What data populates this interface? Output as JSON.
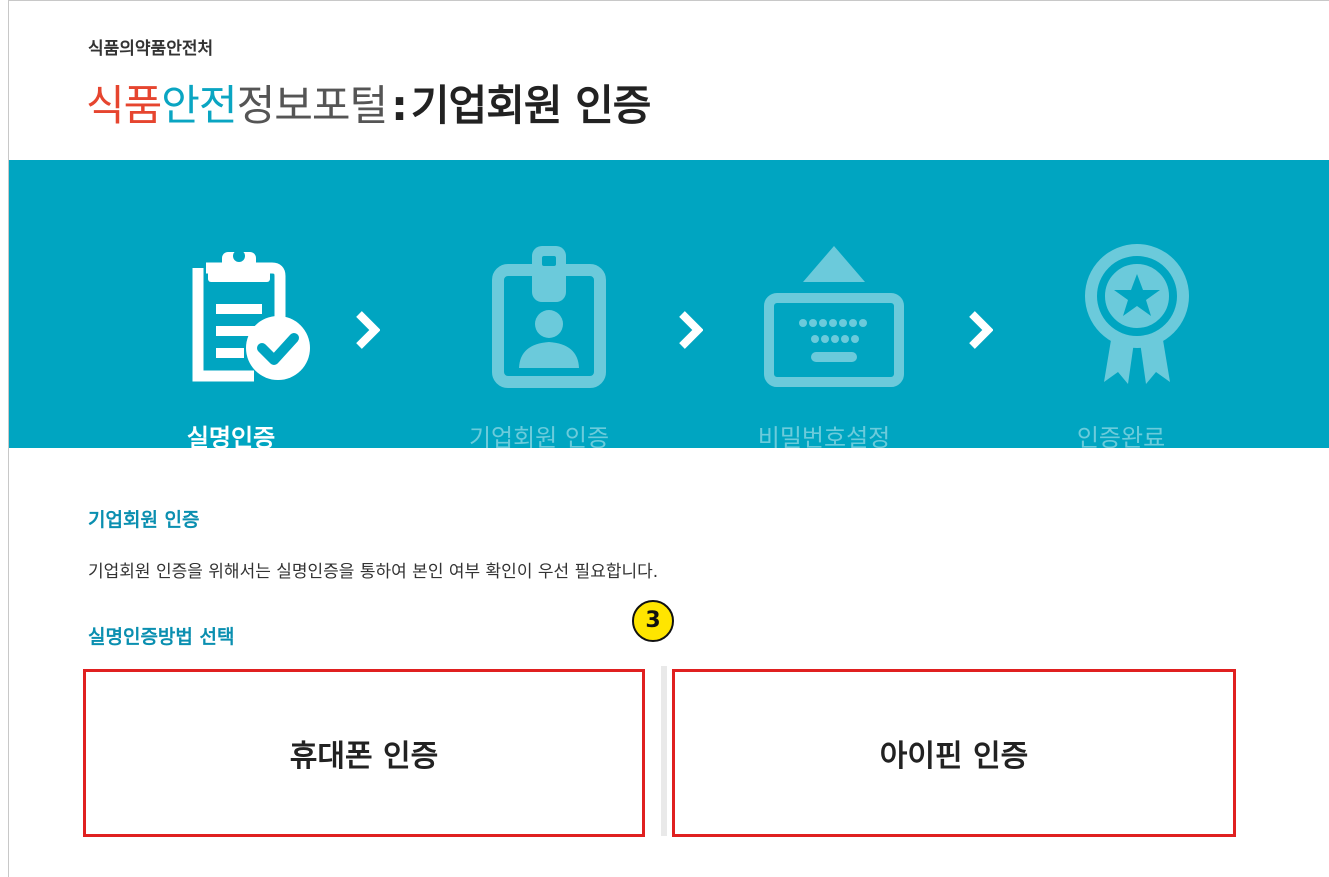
{
  "header": {
    "agency": "식품의약품안전처",
    "title_part1": "식품",
    "title_part2": "안전",
    "title_part3": "정보포털",
    "title_sep": ":",
    "title_part4": "기업회원 인증"
  },
  "steps": [
    {
      "label": "실명인증",
      "icon": "clipboard-check-icon",
      "active": true
    },
    {
      "label": "기업회원 인증",
      "icon": "id-badge-icon",
      "active": false
    },
    {
      "label": "비밀번호설정",
      "icon": "keyboard-icon",
      "active": false
    },
    {
      "label": "인증완료",
      "icon": "award-medal-icon",
      "active": false
    }
  ],
  "main": {
    "section_title": "기업회원 인증",
    "description": "기업회원 인증을 위해서는 실명인증을 통하여 본인 여부 확인이 우선 필요합니다.",
    "method_title": "실명인증방법 선택",
    "annotation_badge": "3",
    "buttons": {
      "phone": "휴대폰 인증",
      "ipin": "아이핀 인증"
    }
  },
  "colors": {
    "banner": "#00a5c1",
    "title_red": "#e6452f",
    "title_teal": "#0aa5c2",
    "highlight_border": "#e02020",
    "badge": "#ffe500"
  }
}
